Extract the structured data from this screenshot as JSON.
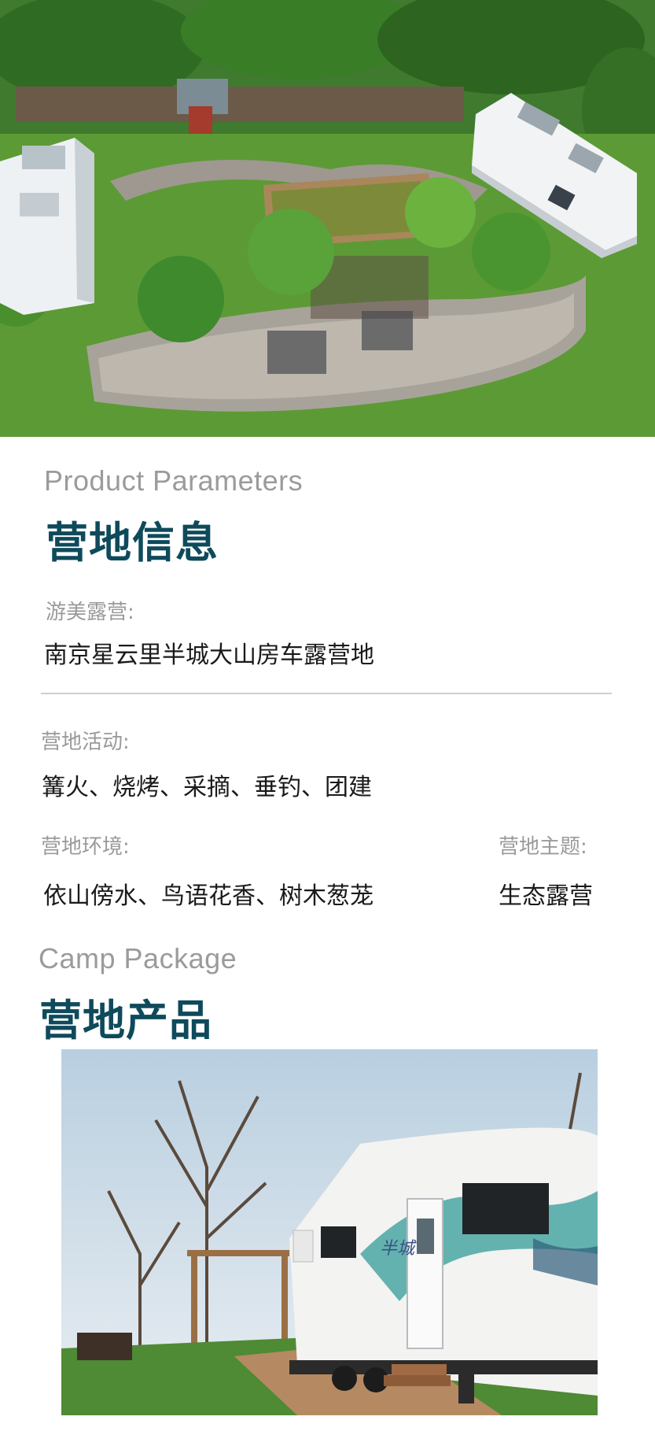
{
  "section1": {
    "en_title": "Product Parameters",
    "zh_title": "营地信息"
  },
  "camp_name": {
    "label": "游美露营:",
    "value": "南京星云里半城大山房车露营地"
  },
  "activities": {
    "label": "营地活动:",
    "value": "篝火、烧烤、采摘、垂钓、团建"
  },
  "environment": {
    "label": "营地环境:",
    "value": "依山傍水、鸟语花香、树木葱茏"
  },
  "theme": {
    "label": "营地主题:",
    "value": "生态露营"
  },
  "section2": {
    "en_title": "Camp Package",
    "zh_title": "营地产品"
  },
  "rv_decal": "半城",
  "colors": {
    "title_teal": "#0e4a5b",
    "label_gray": "#9a9a9a",
    "divider_gray": "#cfcfcf"
  }
}
